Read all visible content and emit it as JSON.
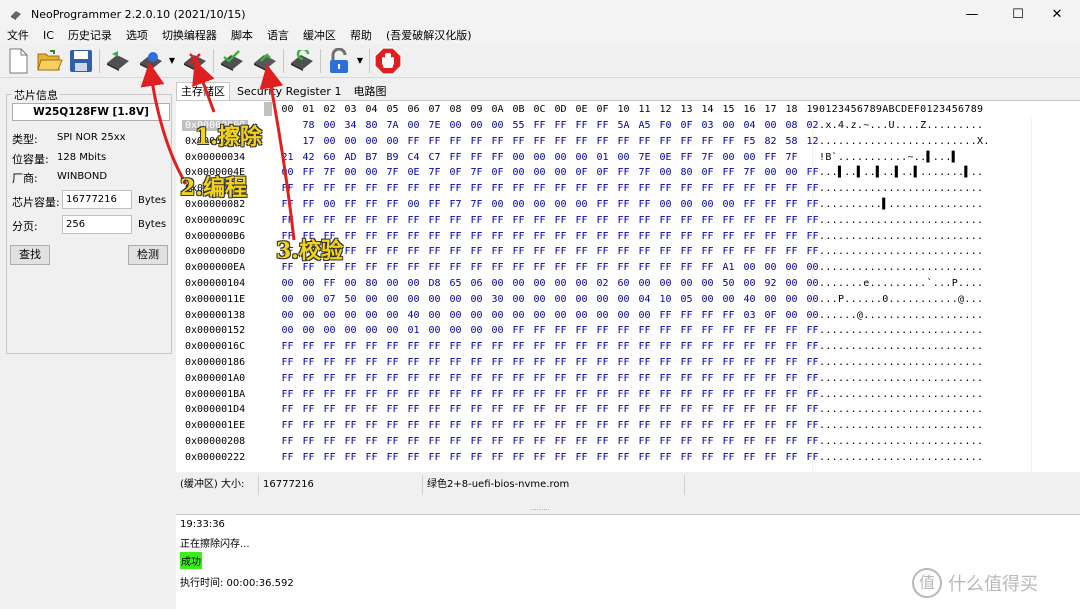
{
  "window": {
    "title": "NeoProgrammer 2.2.0.10 (2021/10/15)",
    "minimize": "—",
    "maximize": "☐",
    "close": "✕"
  },
  "menu": [
    "文件",
    "IC",
    "历史记录",
    "选项",
    "切换编程器",
    "脚本",
    "语言",
    "缓冲区",
    "帮助",
    "(吾爱破解汉化版)"
  ],
  "toolbar": {
    "buttons": [
      {
        "name": "new-file",
        "icon": "file-icon"
      },
      {
        "name": "open",
        "icon": "folder-open-icon"
      },
      {
        "name": "save",
        "icon": "save-icon"
      },
      {
        "name": "read-chip",
        "icon": "chip-read-icon"
      },
      {
        "name": "auto",
        "icon": "chip-auto-icon"
      },
      {
        "name": "erase",
        "icon": "chip-erase-icon"
      },
      {
        "name": "blank-check",
        "icon": "chip-blank-icon"
      },
      {
        "name": "write",
        "icon": "chip-write-icon"
      },
      {
        "name": "verify",
        "icon": "chip-verify-icon"
      },
      {
        "name": "protect",
        "icon": "lock-icon"
      },
      {
        "name": "stop",
        "icon": "stop-icon"
      }
    ],
    "stop_label": "STOP",
    "dropdown_glyph": "▼"
  },
  "left": {
    "group_title": "芯片信息",
    "chip": "W25Q128FW [1.8V]",
    "type_label": "类型:",
    "type_value": "SPI NOR  25xx",
    "bits_label": "位容量:",
    "bits_value": "128 Mbits",
    "vendor_label": "厂商:",
    "vendor_value": "WINBOND",
    "size_label": "芯片容量:",
    "size_value": "16777216",
    "size_unit": "Bytes",
    "page_label": "分页:",
    "page_value": "256",
    "page_unit": "Bytes",
    "find_button": "查找",
    "detect_button": "检测"
  },
  "tabs": [
    "主存储区",
    "Security Register 1",
    "电路图"
  ],
  "hex": {
    "columns": [
      "00",
      "01",
      "02",
      "03",
      "04",
      "05",
      "06",
      "07",
      "08",
      "09",
      "0A",
      "0B",
      "0C",
      "0D",
      "0E",
      "0F",
      "10",
      "11",
      "12",
      "13",
      "14",
      "15",
      "16",
      "17",
      "18",
      "19"
    ],
    "ascii_header": "0123456789ABCDEF0123456789",
    "rows": [
      {
        "addr": "0x00000000",
        "bytes": "xx 78 00 34 80 7A 00 7E 00 00 00 55 FF FF FF FF 5A A5 F0 0F 03 00 04 00 08 02",
        "ascii": ".x.4.z.~...U....Z........."
      },
      {
        "addr": "0x0000001A",
        "bytes": "xx 17 00 00 00 00 FF FF FF FF FF FF FF FF FF FF FF FF FF FF FF FF F5 82 58 12",
        "ascii": ".........................X."
      },
      {
        "addr": "0x00000034",
        "bytes": "21 42 60 AD B7 B9 C4 C7 FF FF FF 00 00 00 00 01 00 7E 0E FF 7F 00 00 FF 7F",
        "ascii": "!B`...........~..▌...▌"
      },
      {
        "addr": "0x0000004E",
        "bytes": "00 FF 7F 00 00 7F 0E 7F 0F 7F 0F 00 00 00 0F 0F FF 7F 00 80 0F FF 7F 00 00 FF",
        "ascii": "...▌..▌..▌..▌..▌.......▌.."
      },
      {
        "addr": "0x00000068",
        "bytes": "FF FF FF FF FF FF FF FF FF FF FF FF FF FF FF FF FF FF FF FF FF FF FF FF FF FF",
        "ascii": ".........................."
      },
      {
        "addr": "0x00000082",
        "bytes": "FF FF 00 FF FF FF 00 FF F7 7F 00 00 00 00 00 FF FF FF 00 00 00 00 FF FF FF FF",
        "ascii": "..........▌..............."
      },
      {
        "addr": "0x0000009C",
        "bytes": "FF FF FF FF FF FF FF FF FF FF FF FF FF FF FF FF FF FF FF FF FF FF FF FF FF FF",
        "ascii": ".........................."
      },
      {
        "addr": "0x000000B6",
        "bytes": "FF FF FF FF FF FF FF FF FF FF FF FF FF FF FF FF FF FF FF FF FF FF FF FF FF FF",
        "ascii": ".........................."
      },
      {
        "addr": "0x000000D0",
        "bytes": "FF FF FF FF FF FF FF FF FF FF FF FF FF FF FF FF FF FF FF FF FF FF FF FF FF FF",
        "ascii": ".........................."
      },
      {
        "addr": "0x000000EA",
        "bytes": "FF FF FF FF FF FF FF FF FF FF FF FF FF FF FF FF FF FF FF FF FF A1 00 00 00 00",
        "ascii": ".........................."
      },
      {
        "addr": "0x00000104",
        "bytes": "00 00 FF 00 80 00 00 D8 65 06 00 00 00 00 00 02 60 00 00 00 00 50 00 92 00 00",
        "ascii": ".......e.........`...P...."
      },
      {
        "addr": "0x0000011E",
        "bytes": "00 00 07 50 00 00 00 00 00 00 30 00 00 00 00 00 00 04 10 05 00 00 40 00 00 00",
        "ascii": "...P......0...........@..."
      },
      {
        "addr": "0x00000138",
        "bytes": "00 00 00 00 00 00 40 00 00 00 00 00 00 00 00 00 00 00 FF FF FF FF 03 0F 00 00",
        "ascii": "......@..................."
      },
      {
        "addr": "0x00000152",
        "bytes": "00 00 00 00 00 00 01 00 00 00 00 FF FF FF FF FF FF FF FF FF FF FF FF FF FF FF",
        "ascii": ".........................."
      },
      {
        "addr": "0x0000016C",
        "bytes": "FF FF FF FF FF FF FF FF FF FF FF FF FF FF FF FF FF FF FF FF FF FF FF FF FF FF",
        "ascii": ".........................."
      },
      {
        "addr": "0x00000186",
        "bytes": "FF FF FF FF FF FF FF FF FF FF FF FF FF FF FF FF FF FF FF FF FF FF FF FF FF FF",
        "ascii": ".........................."
      },
      {
        "addr": "0x000001A0",
        "bytes": "FF FF FF FF FF FF FF FF FF FF FF FF FF FF FF FF FF FF FF FF FF FF FF FF FF FF",
        "ascii": ".........................."
      },
      {
        "addr": "0x000001BA",
        "bytes": "FF FF FF FF FF FF FF FF FF FF FF FF FF FF FF FF FF FF FF FF FF FF FF FF FF FF",
        "ascii": ".........................."
      },
      {
        "addr": "0x000001D4",
        "bytes": "FF FF FF FF FF FF FF FF FF FF FF FF FF FF FF FF FF FF FF FF FF FF FF FF FF FF",
        "ascii": ".........................."
      },
      {
        "addr": "0x000001EE",
        "bytes": "FF FF FF FF FF FF FF FF FF FF FF FF FF FF FF FF FF FF FF FF FF FF FF FF FF FF",
        "ascii": ".........................."
      },
      {
        "addr": "0x00000208",
        "bytes": "FF FF FF FF FF FF FF FF FF FF FF FF FF FF FF FF FF FF FF FF FF FF FF FF FF FF",
        "ascii": ".........................."
      },
      {
        "addr": "0x00000222",
        "bytes": "FF FF FF FF FF FF FF FF FF FF FF FF FF FF FF FF FF FF FF FF FF FF FF FF FF FF",
        "ascii": ".........................."
      }
    ]
  },
  "status": {
    "buffer_label": "(缓冲区)",
    "size_label": "大小:",
    "size_value": "16777216",
    "file_name": "绿色2+8-uefi-bios-nvme.rom"
  },
  "log": {
    "time": "19:33:36",
    "erasing": "正在擦除闪存...",
    "success": "成功",
    "elapsed": "执行时间:   00:00:36.592"
  },
  "annotations": {
    "step1": "1.擦除",
    "step2": "2.编程",
    "step3": "3.校验"
  },
  "watermark": {
    "logo": "值",
    "text": "什么值得买"
  },
  "colors": {
    "hex_byte": "#0000a8",
    "annotation": "#f2d21a",
    "arrow": "#e02020",
    "success_bg": "#38f018"
  }
}
